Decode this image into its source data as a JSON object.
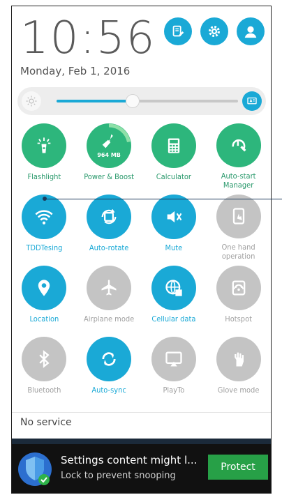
{
  "header": {
    "time": "10:56",
    "date": "Monday, Feb 1, 2016",
    "buttons": [
      {
        "name": "edit-settings-icon"
      },
      {
        "name": "gear-icon"
      },
      {
        "name": "user-icon"
      }
    ]
  },
  "brightness": {
    "level_percent": 42,
    "auto_icon": "auto-brightness-icon"
  },
  "colors": {
    "active": "#1aa9d6",
    "green": "#2db67c",
    "inactive": "#c4c4c4",
    "label_active": "#1aa9d6",
    "label_green": "#27986a",
    "label_inactive": "#a0a0a0"
  },
  "tiles": [
    {
      "label": "Flashlight",
      "icon": "flashlight-icon",
      "state": "green"
    },
    {
      "label": "Power & Boost",
      "icon": "broom-icon",
      "state": "green",
      "badge": "964 MB"
    },
    {
      "label": "Calculator",
      "icon": "calculator-icon",
      "state": "green"
    },
    {
      "label": "Auto-start Manager",
      "icon": "auto-start-icon",
      "state": "green"
    },
    {
      "label": "TDDTesing",
      "icon": "wifi-icon",
      "state": "active"
    },
    {
      "label": "Auto-rotate",
      "icon": "rotate-icon",
      "state": "active"
    },
    {
      "label": "Mute",
      "icon": "mute-icon",
      "state": "active"
    },
    {
      "label": "One hand operation",
      "icon": "one-hand-icon",
      "state": "inactive"
    },
    {
      "label": "Location",
      "icon": "location-icon",
      "state": "active"
    },
    {
      "label": "Airplane mode",
      "icon": "airplane-icon",
      "state": "inactive"
    },
    {
      "label": "Cellular data",
      "icon": "cellular-data-icon",
      "state": "active"
    },
    {
      "label": "Hotspot",
      "icon": "hotspot-icon",
      "state": "inactive"
    },
    {
      "label": "Bluetooth",
      "icon": "bluetooth-icon",
      "state": "inactive"
    },
    {
      "label": "Auto-sync",
      "icon": "sync-icon",
      "state": "active"
    },
    {
      "label": "PlayTo",
      "icon": "cast-icon",
      "state": "inactive"
    },
    {
      "label": "Glove mode",
      "icon": "glove-icon",
      "state": "inactive"
    }
  ],
  "status": {
    "no_service": "No service"
  },
  "notification": {
    "title": "Settings content might l...",
    "subtitle": "Lock to prevent snooping",
    "button": "Protect"
  }
}
